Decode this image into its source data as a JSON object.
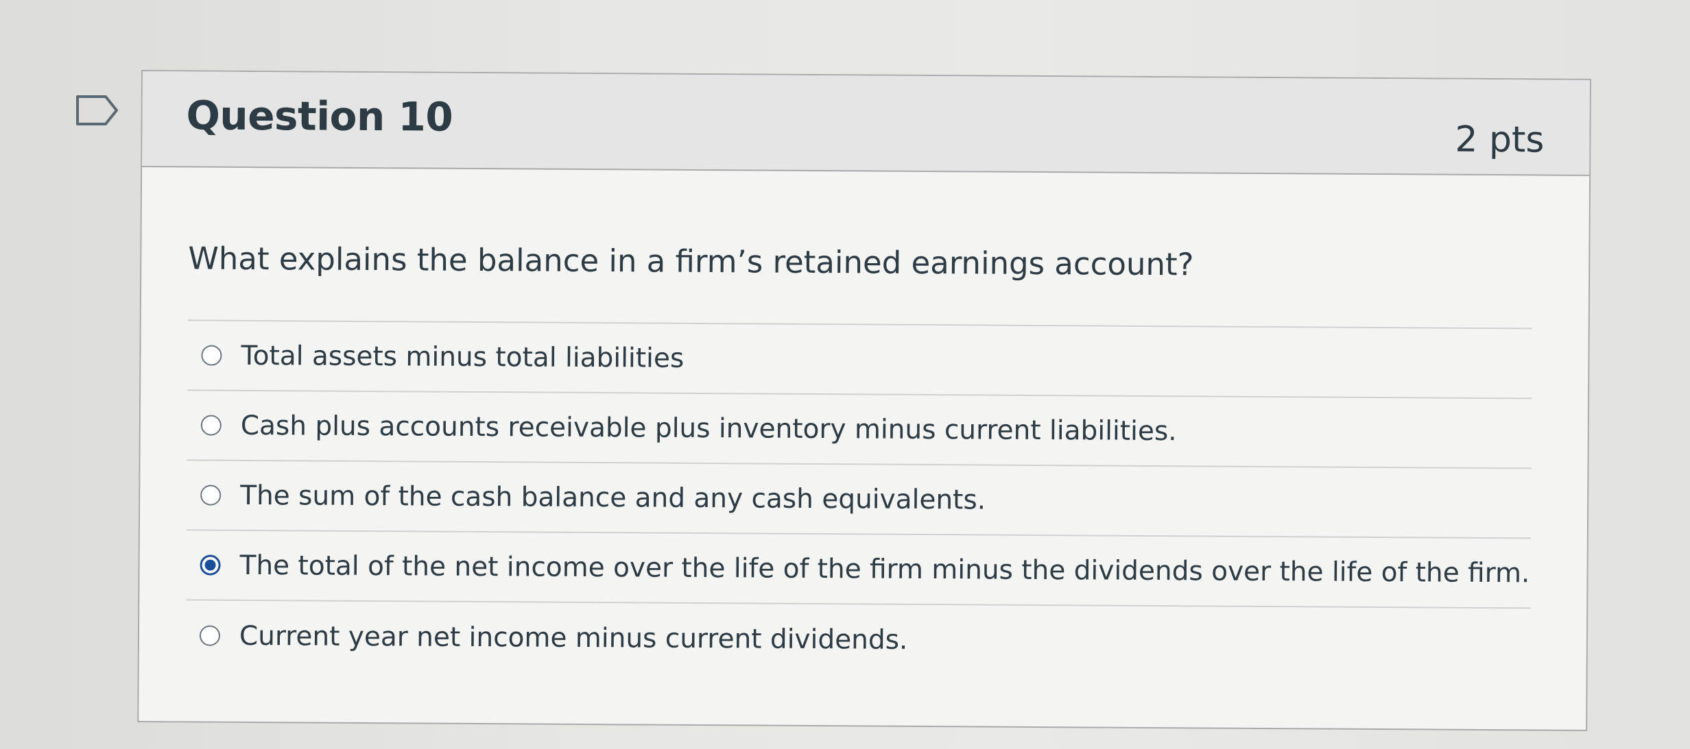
{
  "question": {
    "title": "Question 10",
    "points": "2 pts",
    "text": "What explains the balance in a firm’s retained earnings account?",
    "flag_icon": "flag-outline-icon"
  },
  "answers": [
    {
      "label": "Total assets minus total liabilities",
      "selected": false
    },
    {
      "label": "Cash plus accounts receivable plus inventory minus current liabilities.",
      "selected": false
    },
    {
      "label": "The sum of the cash balance and any cash equivalents.",
      "selected": false
    },
    {
      "label": "The total of the net income over the life of the firm minus the dividends over the life of the firm.",
      "selected": true
    },
    {
      "label": "Current year net income minus current dividends.",
      "selected": false
    }
  ],
  "colors": {
    "accent": "#1b4f9c",
    "text": "#2d3b45",
    "border": "#a8aaac"
  }
}
